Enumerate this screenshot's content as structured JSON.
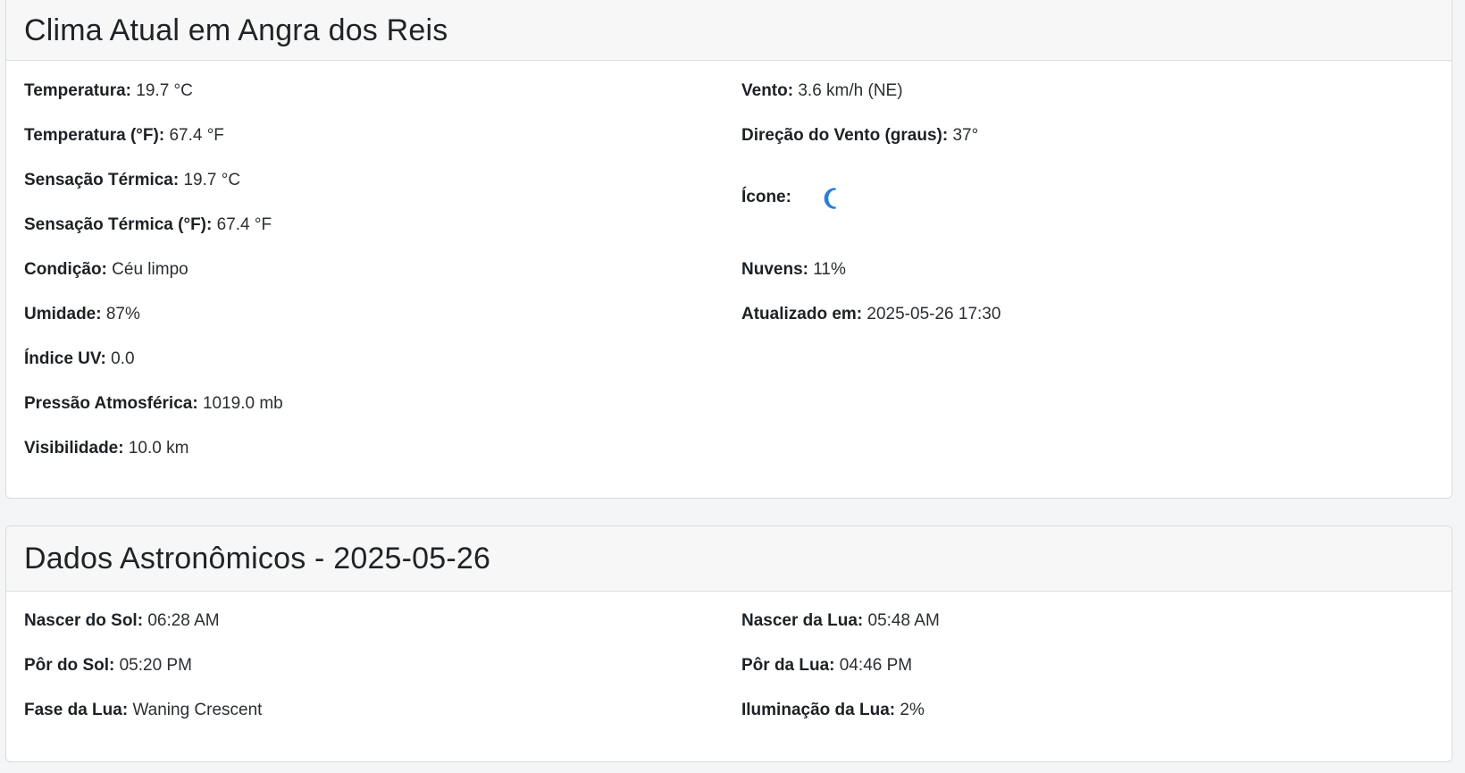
{
  "weather": {
    "title": "Clima Atual em Angra dos Reis",
    "left": [
      {
        "label": "Temperatura:",
        "value": "19.7 °C"
      },
      {
        "label": "Temperatura (°F):",
        "value": "67.4 °F"
      },
      {
        "label": "Sensação Térmica:",
        "value": "19.7 °C"
      },
      {
        "label": "Sensação Térmica (°F):",
        "value": "67.4 °F"
      },
      {
        "label": "Condição:",
        "value": "Céu limpo"
      },
      {
        "label": "Umidade:",
        "value": "87%"
      },
      {
        "label": "Índice UV:",
        "value": "0.0"
      },
      {
        "label": "Pressão Atmosférica:",
        "value": "1019.0 mb"
      },
      {
        "label": "Visibilidade:",
        "value": "10.0 km"
      }
    ],
    "right": {
      "wind": {
        "label": "Vento:",
        "value": "3.6 km/h (NE)"
      },
      "wind_degree": {
        "label": "Direção do Vento (graus):",
        "value": "37°"
      },
      "icon": {
        "label": "Ícone:",
        "icon": "crescent-moon-icon",
        "color": "#2a7fd4"
      },
      "clouds": {
        "label": "Nuvens:",
        "value": "11%"
      },
      "updated": {
        "label": "Atualizado em:",
        "value": "2025-05-26 17:30"
      }
    }
  },
  "astro": {
    "title": "Dados Astronômicos - 2025-05-26",
    "left": [
      {
        "label": "Nascer do Sol:",
        "value": "06:28 AM"
      },
      {
        "label": "Pôr do Sol:",
        "value": "05:20 PM"
      },
      {
        "label": "Fase da Lua:",
        "value": "Waning Crescent"
      }
    ],
    "right": [
      {
        "label": "Nascer da Lua:",
        "value": "05:48 AM"
      },
      {
        "label": "Pôr da Lua:",
        "value": "04:46 PM"
      },
      {
        "label": "Iluminação da Lua:",
        "value": "2%"
      }
    ]
  }
}
